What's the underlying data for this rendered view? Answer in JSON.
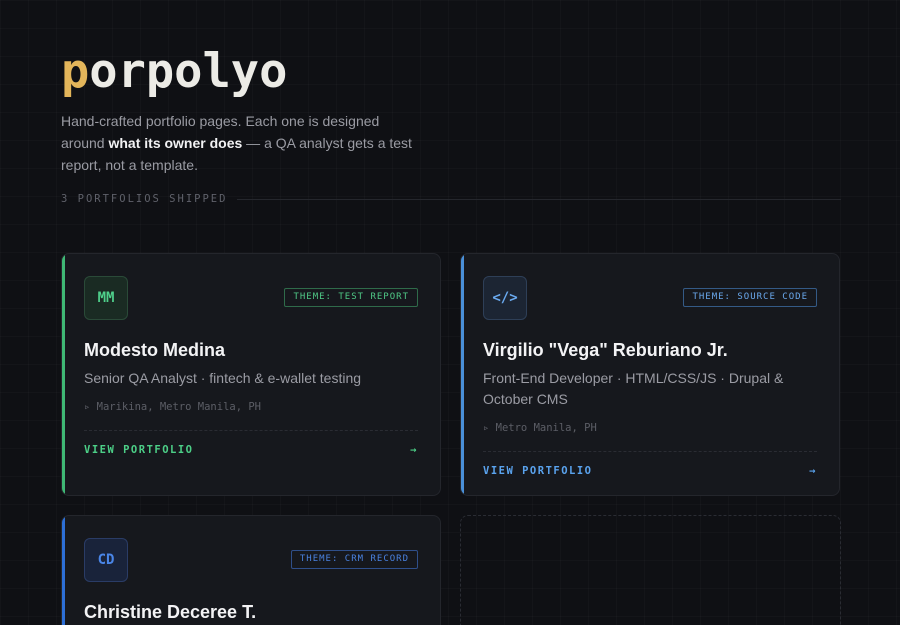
{
  "brand": {
    "logo_first": "p",
    "logo_rest": "orpolyo",
    "accent_color": "#e3b55a"
  },
  "tagline": {
    "part1": "Hand-crafted portfolio pages. Each one is designed around ",
    "emphasis": "what its owner does",
    "part2": " — a QA analyst gets a test report, not a template."
  },
  "count_label": "3 PORTFOLIOS SHIPPED",
  "cards": [
    {
      "initials": "MM",
      "theme": "THEME: TEST REPORT",
      "name": "Modesto Medina",
      "role": "Senior QA Analyst · fintech & e-wallet testing",
      "location": "▹ Marikina, Metro Manila, PH",
      "cta": "VIEW PORTFOLIO",
      "arrow": "→",
      "accent": "#3fb875"
    },
    {
      "initials": "</>",
      "theme": "THEME: SOURCE CODE",
      "name": "Virgilio \"Vega\" Reburiano Jr.",
      "role": "Front-End Developer · HTML/CSS/JS · Drupal & October CMS",
      "location": "▹ Metro Manila, PH",
      "cta": "VIEW PORTFOLIO",
      "arrow": "→",
      "accent": "#4a90d9"
    },
    {
      "initials": "CD",
      "theme": "THEME: CRM RECORD",
      "name": "Christine Deceree T.",
      "accent": "#2d6fd6"
    }
  ]
}
